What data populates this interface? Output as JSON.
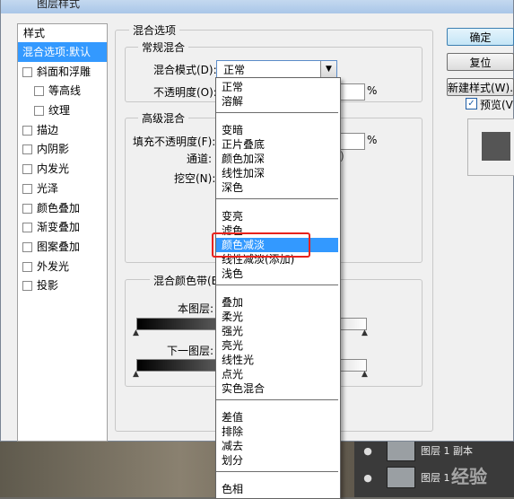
{
  "dialog": {
    "title": "图层样式",
    "styles_header": "样式",
    "style_items": [
      {
        "label": "混合选项:默认",
        "checkbox": false,
        "selected": true,
        "sub": false
      },
      {
        "label": "斜面和浮雕",
        "checkbox": true,
        "sub": false
      },
      {
        "label": "等高线",
        "checkbox": true,
        "sub": true
      },
      {
        "label": "纹理",
        "checkbox": true,
        "sub": true
      },
      {
        "label": "描边",
        "checkbox": true,
        "sub": false
      },
      {
        "label": "内阴影",
        "checkbox": true,
        "sub": false
      },
      {
        "label": "内发光",
        "checkbox": true,
        "sub": false
      },
      {
        "label": "光泽",
        "checkbox": true,
        "sub": false
      },
      {
        "label": "颜色叠加",
        "checkbox": true,
        "sub": false
      },
      {
        "label": "渐变叠加",
        "checkbox": true,
        "sub": false
      },
      {
        "label": "图案叠加",
        "checkbox": true,
        "sub": false
      },
      {
        "label": "外发光",
        "checkbox": true,
        "sub": false
      },
      {
        "label": "投影",
        "checkbox": true,
        "sub": false
      }
    ],
    "blend_options_title": "混合选项",
    "general_blending": {
      "title": "常规混合",
      "blend_mode_label": "混合模式(D):",
      "blend_mode_value": "正常",
      "opacity_label": "不透明度(O):",
      "opacity_unit": "%"
    },
    "advanced_blending": {
      "title": "高级混合",
      "fill_opacity_label": "填充不透明度(F):",
      "fill_opacity_unit": "%",
      "channels_label": "通道:",
      "knockout_label": "挖空(N):"
    },
    "blend_if": {
      "title": "混合颜色带(E):",
      "this_layer_label": "本图层:",
      "underlying_label": "下一图层:"
    },
    "buttons": {
      "ok": "确定",
      "reset": "复位",
      "new_style": "新建样式(W)...",
      "preview": "预览(V)"
    }
  },
  "dropdown": {
    "items": [
      {
        "label": "正常",
        "group": 0
      },
      {
        "label": "溶解",
        "group": 0
      },
      {
        "label": "变暗",
        "group": 1
      },
      {
        "label": "正片叠底",
        "group": 1
      },
      {
        "label": "颜色加深",
        "group": 1
      },
      {
        "label": "线性加深",
        "group": 1
      },
      {
        "label": "深色",
        "group": 1
      },
      {
        "label": "变亮",
        "group": 2
      },
      {
        "label": "滤色",
        "group": 2
      },
      {
        "label": "颜色减淡",
        "group": 2,
        "selected": true
      },
      {
        "label": "线性减淡(添加)",
        "group": 2
      },
      {
        "label": "浅色",
        "group": 2
      },
      {
        "label": "叠加",
        "group": 3
      },
      {
        "label": "柔光",
        "group": 3
      },
      {
        "label": "强光",
        "group": 3
      },
      {
        "label": "亮光",
        "group": 3
      },
      {
        "label": "线性光",
        "group": 3
      },
      {
        "label": "点光",
        "group": 3
      },
      {
        "label": "实色混合",
        "group": 3
      },
      {
        "label": "差值",
        "group": 4
      },
      {
        "label": "排除",
        "group": 4
      },
      {
        "label": "减去",
        "group": 4
      },
      {
        "label": "划分",
        "group": 4
      },
      {
        "label": "色相",
        "group": 5
      }
    ]
  },
  "layers_panel": {
    "layers": [
      {
        "name": "图层 1 副本"
      },
      {
        "name": "图层 1"
      }
    ]
  },
  "watermark": "经验"
}
